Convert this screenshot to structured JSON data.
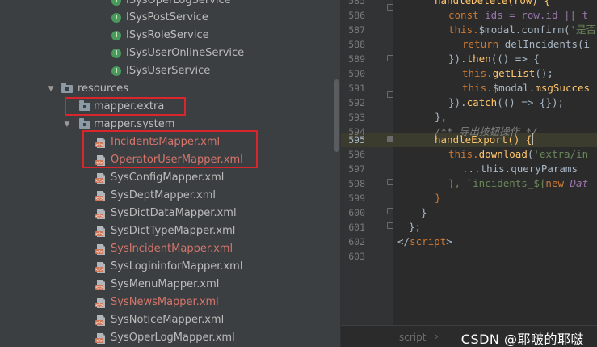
{
  "tree": {
    "services": [
      "ISysOperLogService",
      "ISysPostService",
      "ISysRoleService",
      "ISysUserOnlineService",
      "ISysUserService"
    ],
    "resources_folder": "resources",
    "mapper_extra": "mapper.extra",
    "mapper_system": "mapper.system",
    "mappers": [
      {
        "label": "IncidentsMapper.xml",
        "modified": true
      },
      {
        "label": "OperatorUserMapper.xml",
        "modified": true
      },
      {
        "label": "SysConfigMapper.xml",
        "modified": false
      },
      {
        "label": "SysDeptMapper.xml",
        "modified": false
      },
      {
        "label": "SysDictDataMapper.xml",
        "modified": false
      },
      {
        "label": "SysDictTypeMapper.xml",
        "modified": false
      },
      {
        "label": "SysIncidentMapper.xml",
        "modified": true
      },
      {
        "label": "SysLogininforMapper.xml",
        "modified": false
      },
      {
        "label": "SysMenuMapper.xml",
        "modified": false
      },
      {
        "label": "SysNewsMapper.xml",
        "modified": true
      },
      {
        "label": "SysNoticeMapper.xml",
        "modified": false
      },
      {
        "label": "SysOperLogMapper.xml",
        "modified": false
      }
    ]
  },
  "editor": {
    "lines": [
      "585",
      "586",
      "587",
      "588",
      "589",
      "590",
      "591",
      "592",
      "593",
      "594",
      "595",
      "596",
      "597",
      "598",
      "599",
      "600",
      "601",
      "602",
      "603"
    ],
    "current_line": "595",
    "code": {
      "l585": "handleDelete(row) {",
      "l586_a": "const ",
      "l586_b": "ids = row.id || t",
      "l587_a": "this.",
      "l587_b": "$modal",
      "l587_c": ".confirm(",
      "l587_d": "'是否",
      "l588_a": "return ",
      "l588_b": "delIncidents(i",
      "l589_a": "}).",
      "l589_b": "then",
      "l589_c": "(() => {",
      "l590_a": "this.",
      "l590_b": "getList",
      "l590_c": "();",
      "l591_a": "this.",
      "l591_b": "$modal",
      "l591_c": ".",
      "l591_d": "msgSucces",
      "l592_a": "}).",
      "l592_b": "catch",
      "l592_c": "(() => {});",
      "l593": "},",
      "l594": "/** 导出按钮操作 */",
      "l595": "handleExport() {",
      "l596_a": "this.",
      "l596_b": "download",
      "l596_c": "(",
      "l596_d": "'extra/in",
      "l597": "...this.queryParams",
      "l598_a": "}, `incidents_${",
      "l598_b": "new ",
      "l598_c": "Dat",
      "l599": "}",
      "l600": "}",
      "l601": "};",
      "l602_a": "</",
      "l602_b": "script",
      "l602_c": ">",
      "l603": ""
    },
    "breadcrumb": "script",
    "watermark": "CSDN @耶啵的耶啵"
  },
  "colors": {
    "modified_file": "#d5756c",
    "annotation_box": "#d9262c",
    "interface_icon": "#4a9a5b"
  }
}
